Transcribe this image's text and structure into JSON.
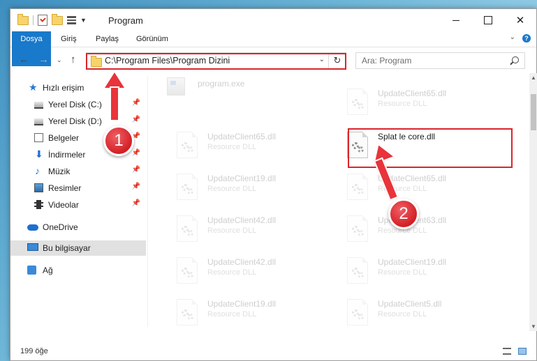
{
  "window": {
    "title": "Program"
  },
  "ribbon": {
    "tabs": [
      "Dosya",
      "Giriş",
      "Paylaş",
      "Görünüm"
    ]
  },
  "address": {
    "path": "C:\\Program Files\\Program Dizini",
    "search_placeholder": "Ara: Program"
  },
  "sidebar": {
    "items": [
      {
        "label": "Hızlı erişim",
        "icon": "star-icon"
      },
      {
        "label": "Yerel Disk (C:)",
        "icon": "drive-icon"
      },
      {
        "label": "Yerel Disk (D:)",
        "icon": "drive-icon"
      },
      {
        "label": "Belgeler",
        "icon": "documents-icon"
      },
      {
        "label": "İndirmeler",
        "icon": "download-icon"
      },
      {
        "label": "Müzik",
        "icon": "music-icon"
      },
      {
        "label": "Resimler",
        "icon": "pictures-icon"
      },
      {
        "label": "Videolar",
        "icon": "videos-icon"
      },
      {
        "label": "OneDrive",
        "icon": "cloud-icon"
      },
      {
        "label": "Bu bilgisayar",
        "icon": "computer-icon",
        "selected": true
      },
      {
        "label": "Ağ",
        "icon": "network-icon"
      }
    ]
  },
  "files": [
    {
      "name": "program.exe",
      "type": "",
      "faded": true
    },
    {
      "name": "UpdateClient65.dll",
      "type": "Resource DLL",
      "faded": true
    },
    {
      "name": "UpdateClient65.dll",
      "type": "Resource DLL",
      "faded": true
    },
    {
      "name": "Splat le core.dll",
      "type": "",
      "faded": false
    },
    {
      "name": "UpdateClient19.dll",
      "type": "Resource DLL",
      "faded": true
    },
    {
      "name": "UpdateClient65.dll",
      "type": "Resource DLL",
      "faded": true
    },
    {
      "name": "UpdateClient42.dll",
      "type": "Resource DLL",
      "faded": true
    },
    {
      "name": "UpdateClient63.dll",
      "type": "Resource DLL",
      "faded": true
    },
    {
      "name": "UpdateClient42.dll",
      "type": "Resource DLL",
      "faded": true
    },
    {
      "name": "UpdateClient19.dll",
      "type": "Resource DLL",
      "faded": true
    },
    {
      "name": "UpdateClient19.dll",
      "type": "Resource DLL",
      "faded": true
    },
    {
      "name": "UpdateClient5.dll",
      "type": "Resource DLL",
      "faded": true
    }
  ],
  "status": {
    "item_count": "199 öğe"
  },
  "annotations": {
    "marker1": "1",
    "marker2": "2",
    "highlight_color": "#d9252b"
  },
  "colors": {
    "accent": "#1979ca"
  }
}
